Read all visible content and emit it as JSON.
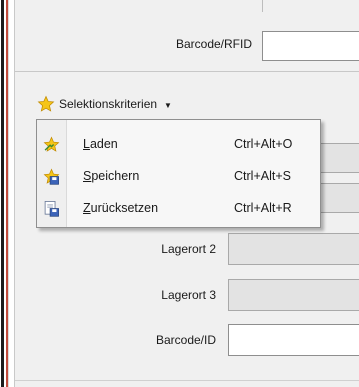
{
  "form": {
    "barcode_rfid_label": "Barcode/RFID",
    "lagerort2_label": "Lagerort 2",
    "lagerort3_label": "Lagerort 3",
    "barcode_id_label": "Barcode/ID"
  },
  "selection": {
    "label": "Selektionskriterien",
    "icon": "star-icon",
    "menu": [
      {
        "mnemonic": "L",
        "rest": "aden",
        "shortcut": "Ctrl+Alt+O",
        "icon": "star-load-icon"
      },
      {
        "mnemonic": "S",
        "rest": "peichern",
        "shortcut": "Ctrl+Alt+S",
        "icon": "star-save-icon"
      },
      {
        "mnemonic": "Z",
        "rest": "urücksetzen",
        "shortcut": "Ctrl+Alt+R",
        "icon": "reset-icon"
      }
    ]
  },
  "colors": {
    "star": "#f5c518",
    "panel_bg": "#f0f0f0",
    "disabled_field": "#e3e3e3"
  }
}
